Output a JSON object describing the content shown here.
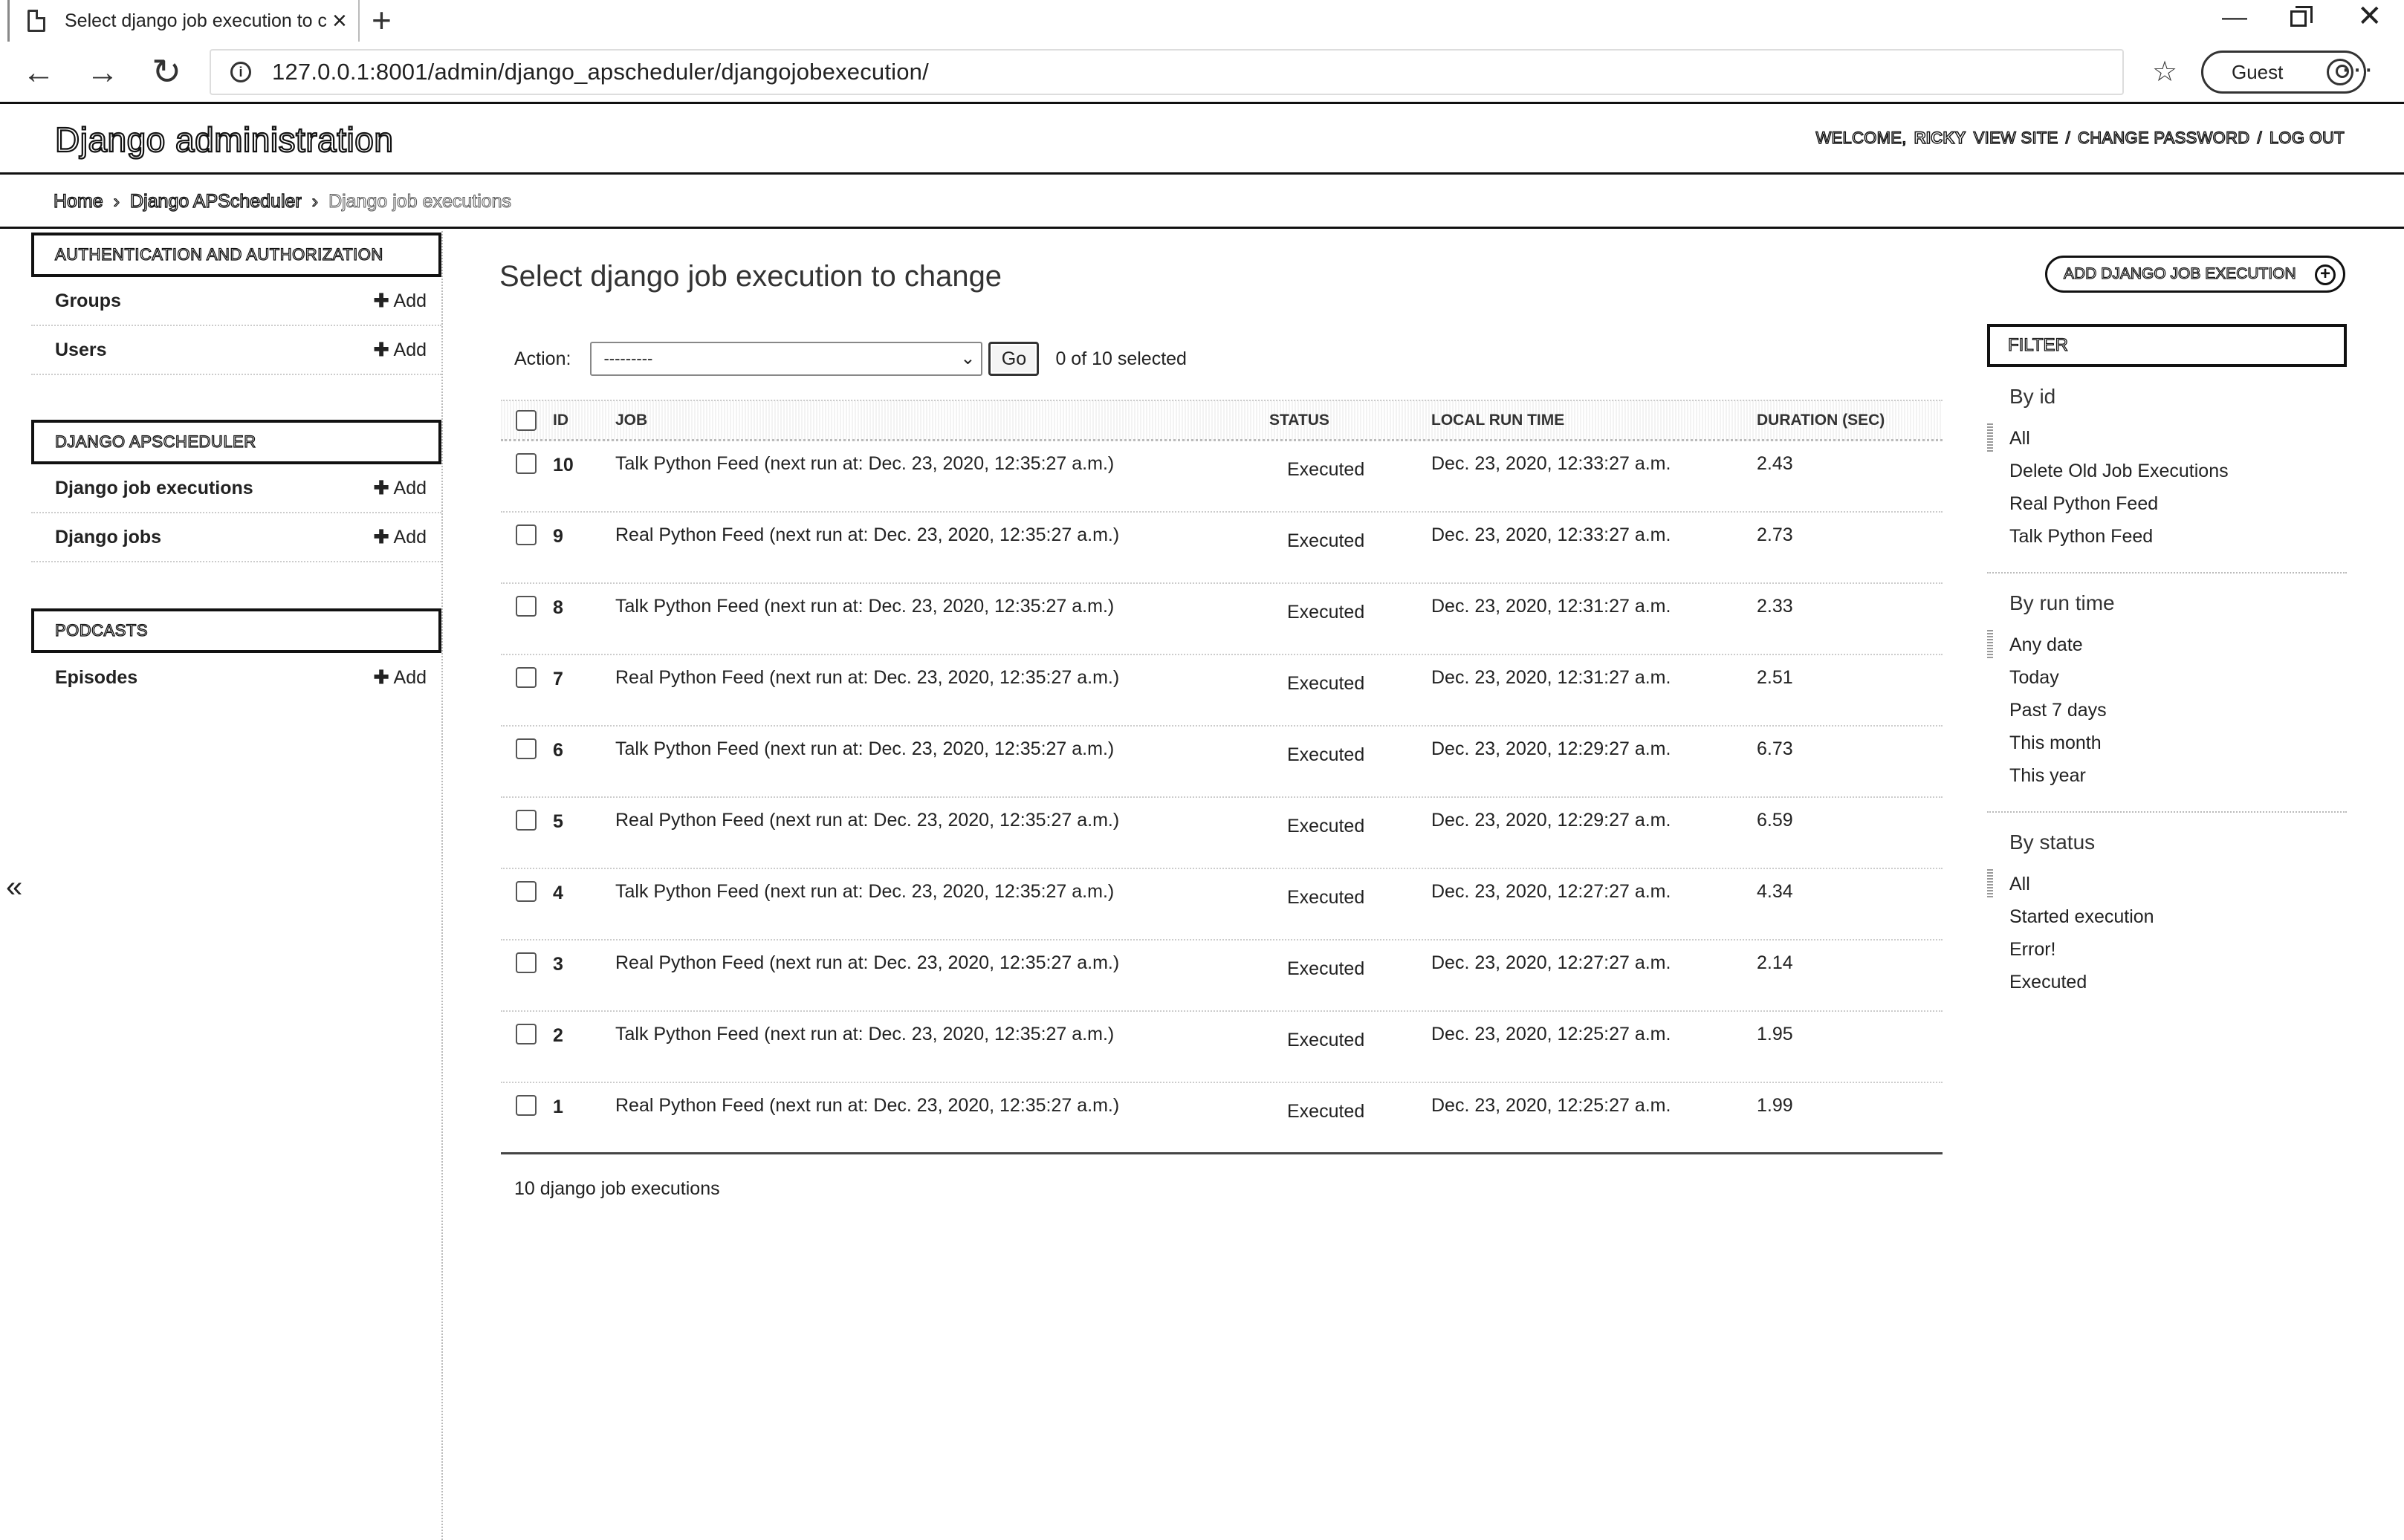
{
  "browser": {
    "tab_title": "Select django job execution to cl",
    "tab_close": "×",
    "new_tab": "+",
    "url": "127.0.0.1:8001/admin/django_apscheduler/djangojobexecution/",
    "profile_label": "Guest",
    "icons": {
      "back": "back-arrow-icon",
      "forward": "forward-arrow-icon",
      "reload": "reload-icon",
      "info": "info-icon",
      "favorites": "favorites-icon",
      "more": "more-icon"
    }
  },
  "header": {
    "site_name": "Django administration",
    "welcome": "WELCOME,",
    "username": "RICKY",
    "view_site": "VIEW SITE",
    "sep": "/",
    "change_password": "CHANGE PASSWORD",
    "log_out": "LOG OUT"
  },
  "breadcrumbs": {
    "home": "Home",
    "app": "Django APScheduler",
    "current": "Django job executions",
    "sep": "›"
  },
  "sidebar": {
    "collapse_label": "«",
    "modules": [
      {
        "caption": "Authentication and Authorization",
        "rows": [
          {
            "label": "Groups",
            "add": "Add"
          },
          {
            "label": "Users",
            "add": "Add"
          }
        ]
      },
      {
        "caption": "Django APScheduler",
        "rows": [
          {
            "label": "Django job executions",
            "add": "Add"
          },
          {
            "label": "Django jobs",
            "add": "Add"
          }
        ]
      },
      {
        "caption": "Podcasts",
        "rows": [
          {
            "label": "Episodes",
            "add": "Add"
          }
        ]
      }
    ]
  },
  "main": {
    "title": "Select django job execution to change",
    "add_button": "Add django job execution",
    "actions": {
      "label": "Action:",
      "selected_value": "---------",
      "go": "Go",
      "counter": "0 of 10 selected"
    },
    "columns": [
      "ID",
      "JOB",
      "STATUS",
      "LOCAL RUN TIME",
      "DURATION (SEC)"
    ],
    "rows": [
      {
        "id": "10",
        "job": "Talk Python Feed (next run at: Dec. 23, 2020, 12:35:27 a.m.)",
        "status": "Executed",
        "run_time": "Dec. 23, 2020, 12:33:27 a.m.",
        "duration": "2.43"
      },
      {
        "id": "9",
        "job": "Real Python Feed (next run at: Dec. 23, 2020, 12:35:27 a.m.)",
        "status": "Executed",
        "run_time": "Dec. 23, 2020, 12:33:27 a.m.",
        "duration": "2.73"
      },
      {
        "id": "8",
        "job": "Talk Python Feed (next run at: Dec. 23, 2020, 12:35:27 a.m.)",
        "status": "Executed",
        "run_time": "Dec. 23, 2020, 12:31:27 a.m.",
        "duration": "2.33"
      },
      {
        "id": "7",
        "job": "Real Python Feed (next run at: Dec. 23, 2020, 12:35:27 a.m.)",
        "status": "Executed",
        "run_time": "Dec. 23, 2020, 12:31:27 a.m.",
        "duration": "2.51"
      },
      {
        "id": "6",
        "job": "Talk Python Feed (next run at: Dec. 23, 2020, 12:35:27 a.m.)",
        "status": "Executed",
        "run_time": "Dec. 23, 2020, 12:29:27 a.m.",
        "duration": "6.73"
      },
      {
        "id": "5",
        "job": "Real Python Feed (next run at: Dec. 23, 2020, 12:35:27 a.m.)",
        "status": "Executed",
        "run_time": "Dec. 23, 2020, 12:29:27 a.m.",
        "duration": "6.59"
      },
      {
        "id": "4",
        "job": "Talk Python Feed (next run at: Dec. 23, 2020, 12:35:27 a.m.)",
        "status": "Executed",
        "run_time": "Dec. 23, 2020, 12:27:27 a.m.",
        "duration": "4.34"
      },
      {
        "id": "3",
        "job": "Real Python Feed (next run at: Dec. 23, 2020, 12:35:27 a.m.)",
        "status": "Executed",
        "run_time": "Dec. 23, 2020, 12:27:27 a.m.",
        "duration": "2.14"
      },
      {
        "id": "2",
        "job": "Talk Python Feed (next run at: Dec. 23, 2020, 12:35:27 a.m.)",
        "status": "Executed",
        "run_time": "Dec. 23, 2020, 12:25:27 a.m.",
        "duration": "1.95"
      },
      {
        "id": "1",
        "job": "Real Python Feed (next run at: Dec. 23, 2020, 12:35:27 a.m.)",
        "status": "Executed",
        "run_time": "Dec. 23, 2020, 12:25:27 a.m.",
        "duration": "1.99"
      }
    ],
    "paginator": "10 django job executions"
  },
  "filter": {
    "caption": "Filter",
    "groups": [
      {
        "title": "By id",
        "options": [
          "All",
          "Delete Old Job Executions",
          "Real Python Feed",
          "Talk Python Feed"
        ],
        "selected": 0
      },
      {
        "title": "By run time",
        "options": [
          "Any date",
          "Today",
          "Past 7 days",
          "This month",
          "This year"
        ],
        "selected": 0
      },
      {
        "title": "By status",
        "options": [
          "All",
          "Started execution",
          "Error!",
          "Executed"
        ],
        "selected": 0
      }
    ]
  }
}
